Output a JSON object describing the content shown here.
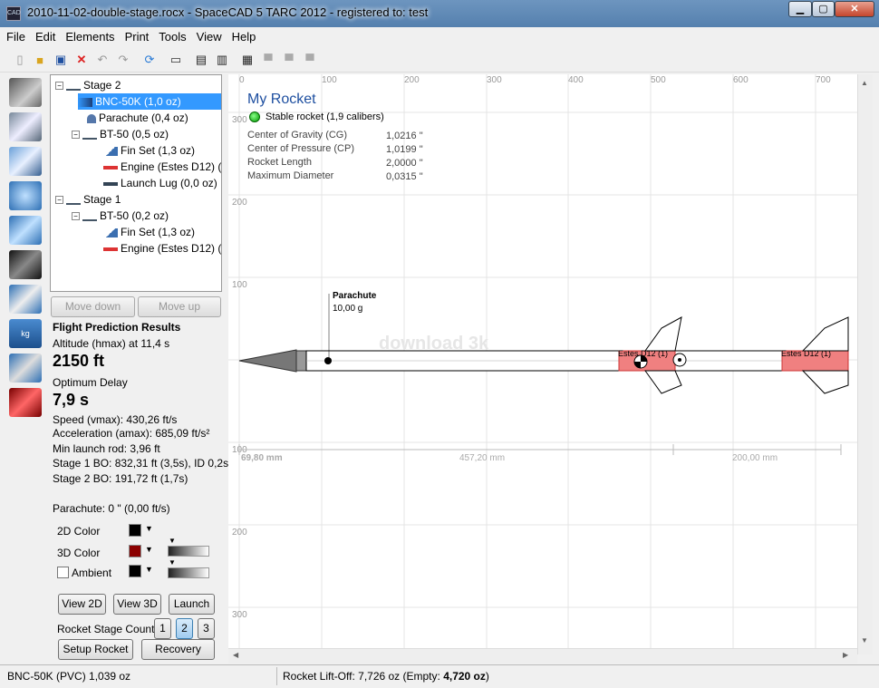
{
  "window": {
    "title": "2010-11-02-double-stage.rocx - SpaceCAD 5 TARC 2012 - registered to: test",
    "app_icon": "CAD"
  },
  "menu": [
    "File",
    "Edit",
    "Elements",
    "Print",
    "Tools",
    "View",
    "Help"
  ],
  "tree": [
    {
      "label": "Stage 2",
      "icon": "stage-icon",
      "expander": "−"
    },
    {
      "label": "BNC-50K (1,0 oz)",
      "icon": "nosecone-icon"
    },
    {
      "label": "Parachute (0,4 oz)",
      "icon": "parachute-icon"
    },
    {
      "label": "BT-50 (0,5 oz)",
      "icon": "bodytube-icon",
      "expander": "−"
    },
    {
      "label": "Fin Set (1,3 oz)",
      "icon": "finset-icon"
    },
    {
      "label": "Engine (Estes D12) (1,",
      "icon": "engine-icon"
    },
    {
      "label": "Launch Lug (0,0 oz)",
      "icon": "launchlug-icon"
    },
    {
      "label": "Stage 1",
      "icon": "stage-icon",
      "expander": "−"
    },
    {
      "label": "BT-50 (0,2 oz)",
      "icon": "bodytube-icon",
      "expander": "−"
    },
    {
      "label": "Fin Set (1,3 oz)",
      "icon": "finset-icon"
    },
    {
      "label": "Engine (Estes D12) (1,",
      "icon": "engine-icon"
    }
  ],
  "buttons": {
    "move_down": "Move down",
    "move_up": "Move up",
    "view2d": "View 2D",
    "view3d": "View 3D",
    "launch": "Launch",
    "setup": "Setup Rocket",
    "recovery": "Recovery"
  },
  "flight": {
    "heading": "Flight Prediction Results",
    "altitude_label": "Altitude (hmax) at 11,4 s",
    "altitude_value": "2150 ft",
    "delay_label": "Optimum Delay",
    "delay_value": "7,9 s",
    "speed": "Speed (vmax): 430,26 ft/s",
    "accel": "Acceleration (amax): 685,09 ft/s²",
    "rod": "Min launch rod: 3,96 ft",
    "stage1": "Stage 1 BO: 832,31 ft (3,5s), ID 0,2s",
    "stage2": "Stage 2 BO: 191,72 ft (1,7s)",
    "parachute": "Parachute: 0 \" (0,00 ft/s)"
  },
  "colors": {
    "color2d_label": "2D Color",
    "color3d_label": "3D Color",
    "ambient_label": "Ambient",
    "c2d": "#000000",
    "c3d": "#8b0000",
    "amb": "#000000"
  },
  "stage_count": {
    "label": "Rocket Stage Count",
    "options": [
      "1",
      "2",
      "3"
    ],
    "selected": "2"
  },
  "rocket": {
    "name": "My Rocket",
    "stability": "Stable rocket (1,9 calibers)",
    "props": [
      {
        "k": "Center of Gravity (CG)",
        "v": "1,0216 \""
      },
      {
        "k": "Center of Pressure (CP)",
        "v": "1,0199 \""
      },
      {
        "k": "Rocket Length",
        "v": "2,0000 \""
      },
      {
        "k": "Maximum Diameter",
        "v": "0,0315 \""
      }
    ],
    "parachute_label": "Parachute",
    "parachute_mass": "10,00 g",
    "engine1": "Estes D12 (1)",
    "engine2": "Estes D12 (1)"
  },
  "ruler": {
    "x": [
      "0",
      "100",
      "200",
      "300",
      "400",
      "500",
      "600",
      "700"
    ],
    "y": [
      "300",
      "200",
      "100",
      "100",
      "200",
      "300"
    ]
  },
  "dims": [
    "69,80 mm",
    "457,20 mm",
    "200,00 mm"
  ],
  "watermark": "download 3k",
  "status": {
    "left": "BNC-50K (PVC) 1,039 oz",
    "right_prefix": "Rocket Lift-Off: 7,726 oz (Empty: ",
    "right_bold": "4,720 oz",
    ")": ")"
  }
}
